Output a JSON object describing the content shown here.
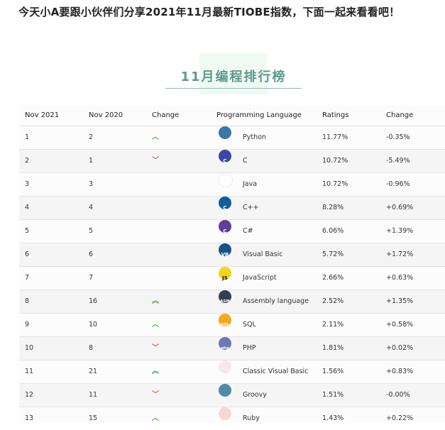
{
  "intro_text": "今天小A要跟小伙伴们分享2021年11月最新TIOBE指数，下面一起来看看吧！",
  "title": "11月编程排行榜",
  "headers": [
    "Nov 2021",
    "Nov 2020",
    "Change",
    "Programming Language",
    "Ratings",
    "Change"
  ],
  "rows": [
    {
      "now": "1",
      "prev": "2",
      "trend": "up",
      "lang": "Python",
      "rating": "11.77%",
      "change": "-0.35%",
      "icon": "python-icon"
    },
    {
      "now": "2",
      "prev": "1",
      "trend": "down",
      "lang": "C",
      "rating": "10.72%",
      "change": "-5.49%",
      "icon": "c-icon"
    },
    {
      "now": "3",
      "prev": "3",
      "trend": "",
      "lang": "Java",
      "rating": "10.72%",
      "change": "-0.96%",
      "icon": "java-icon"
    },
    {
      "now": "4",
      "prev": "4",
      "trend": "",
      "lang": "C++",
      "rating": "8.28%",
      "change": "+0.69%",
      "icon": "cpp-icon"
    },
    {
      "now": "5",
      "prev": "5",
      "trend": "",
      "lang": "C#",
      "rating": "6.06%",
      "change": "+1.39%",
      "icon": "csharp-icon"
    },
    {
      "now": "6",
      "prev": "6",
      "trend": "",
      "lang": "Visual Basic",
      "rating": "5.72%",
      "change": "+1.72%",
      "icon": "visual-basic-icon"
    },
    {
      "now": "7",
      "prev": "7",
      "trend": "",
      "lang": "JavaScript",
      "rating": "2.66%",
      "change": "+0.63%",
      "icon": "javascript-icon"
    },
    {
      "now": "8",
      "prev": "16",
      "trend": "up2",
      "lang": "Assembly language",
      "rating": "2.52%",
      "change": "+1.35%",
      "icon": "assembly-icon"
    },
    {
      "now": "9",
      "prev": "10",
      "trend": "up",
      "lang": "SQL",
      "rating": "2.11%",
      "change": "+0.58%",
      "icon": "sql-icon"
    },
    {
      "now": "10",
      "prev": "8",
      "trend": "down",
      "lang": "PHP",
      "rating": "1.81%",
      "change": "+0.02%",
      "icon": "php-icon"
    },
    {
      "now": "11",
      "prev": "21",
      "trend": "up2",
      "lang": "Classic Visual Basic",
      "rating": "1.56%",
      "change": "+0.83%",
      "icon": "classic-visual-basic-icon"
    },
    {
      "now": "12",
      "prev": "11",
      "trend": "down",
      "lang": "Groovy",
      "rating": "1.51%",
      "change": "-0.00%",
      "icon": "groovy-icon"
    },
    {
      "now": "13",
      "prev": "15",
      "trend": "up",
      "lang": "Ruby",
      "rating": "1.43%",
      "change": "+0.22%",
      "icon": "ruby-icon"
    }
  ],
  "logos": {
    "python-icon": {
      "text": "",
      "bg": "#3b77a8"
    },
    "c-icon": {
      "text": "C",
      "bg": "#3a49a6"
    },
    "java-icon": {
      "text": "",
      "bg": "#ffffff"
    },
    "cpp-icon": {
      "text": "C",
      "bg": "#0f5e9c"
    },
    "csharp-icon": {
      "text": "C",
      "bg": "#5b3f99"
    },
    "visual-basic-icon": {
      "text": "VB",
      "bg": "#14528a"
    },
    "javascript-icon": {
      "text": "JS",
      "bg": "#f2d41b"
    },
    "assembly-icon": {
      "text": "ASM",
      "bg": "#34404f"
    },
    "sql-icon": {
      "text": "SQL",
      "bg": "#f4a81d"
    },
    "php-icon": {
      "text": "php",
      "bg": "#6f78b0"
    },
    "classic-visual-basic-icon": {
      "text": "",
      "bg": "#f3e9ee"
    },
    "groovy-icon": {
      "text": "",
      "bg": "#4f8aa8"
    },
    "ruby-icon": {
      "text": "",
      "bg": "#f4d9d0"
    }
  }
}
